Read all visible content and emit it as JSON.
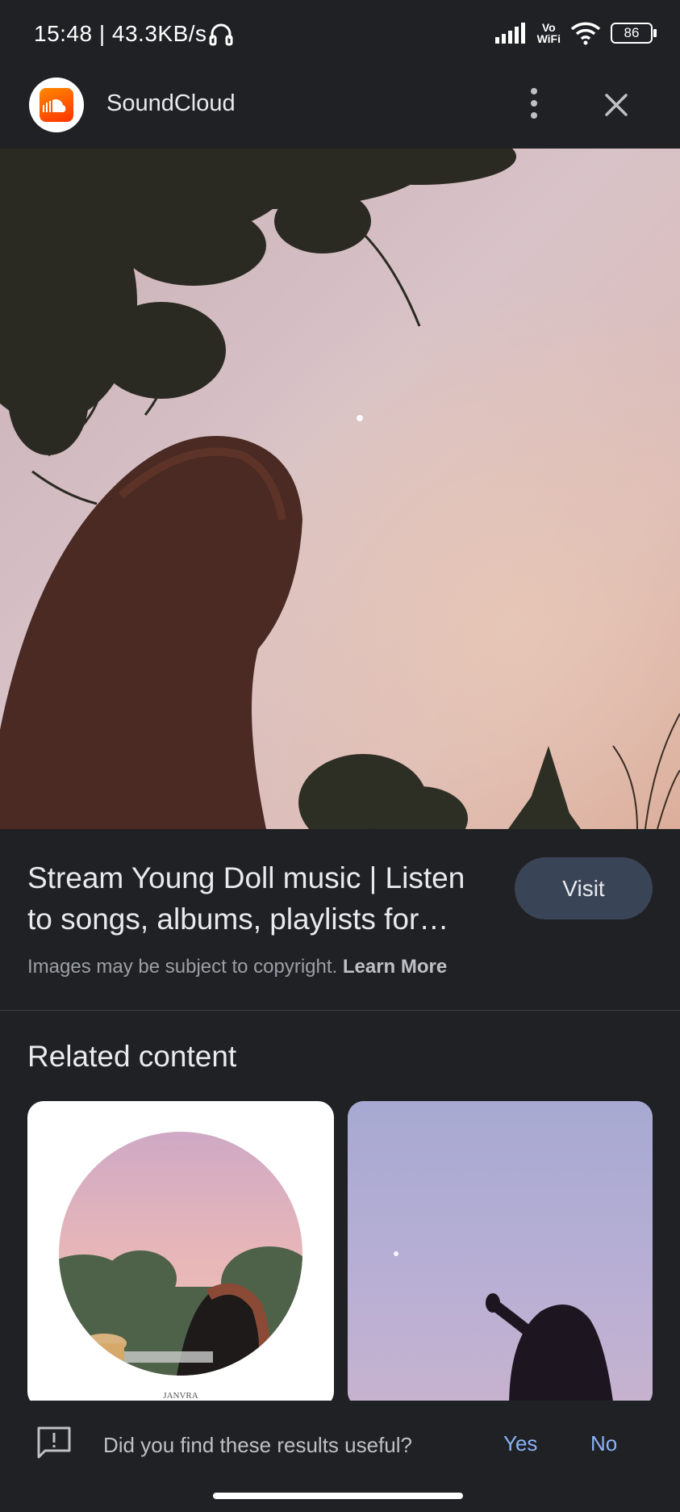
{
  "status_bar": {
    "time_speed": "15:48 | 43.3KB/s",
    "vowifi_top": "Vo",
    "vowifi_bottom": "WiFi",
    "battery": "86"
  },
  "header": {
    "site_name": "SoundCloud",
    "logo_icon": "soundcloud-logo",
    "menu_icon": "more-vert-icon",
    "close_icon": "close-icon"
  },
  "result": {
    "title": "Stream Young Doll music | Listen to songs, albums, playlists for…",
    "visit_label": "Visit",
    "copyright_text": "Images may be subject to copyright. ",
    "learn_more": "Learn More"
  },
  "related": {
    "heading": "Related content",
    "card1_caption": "JANVRA"
  },
  "feedback": {
    "question": "Did you find these results useful?",
    "yes_label": "Yes",
    "no_label": "No"
  },
  "colors": {
    "background": "#202124",
    "accent_link": "#8ab4f8",
    "visit_button": "#394457",
    "soundcloud_orange": "#ff5500"
  }
}
